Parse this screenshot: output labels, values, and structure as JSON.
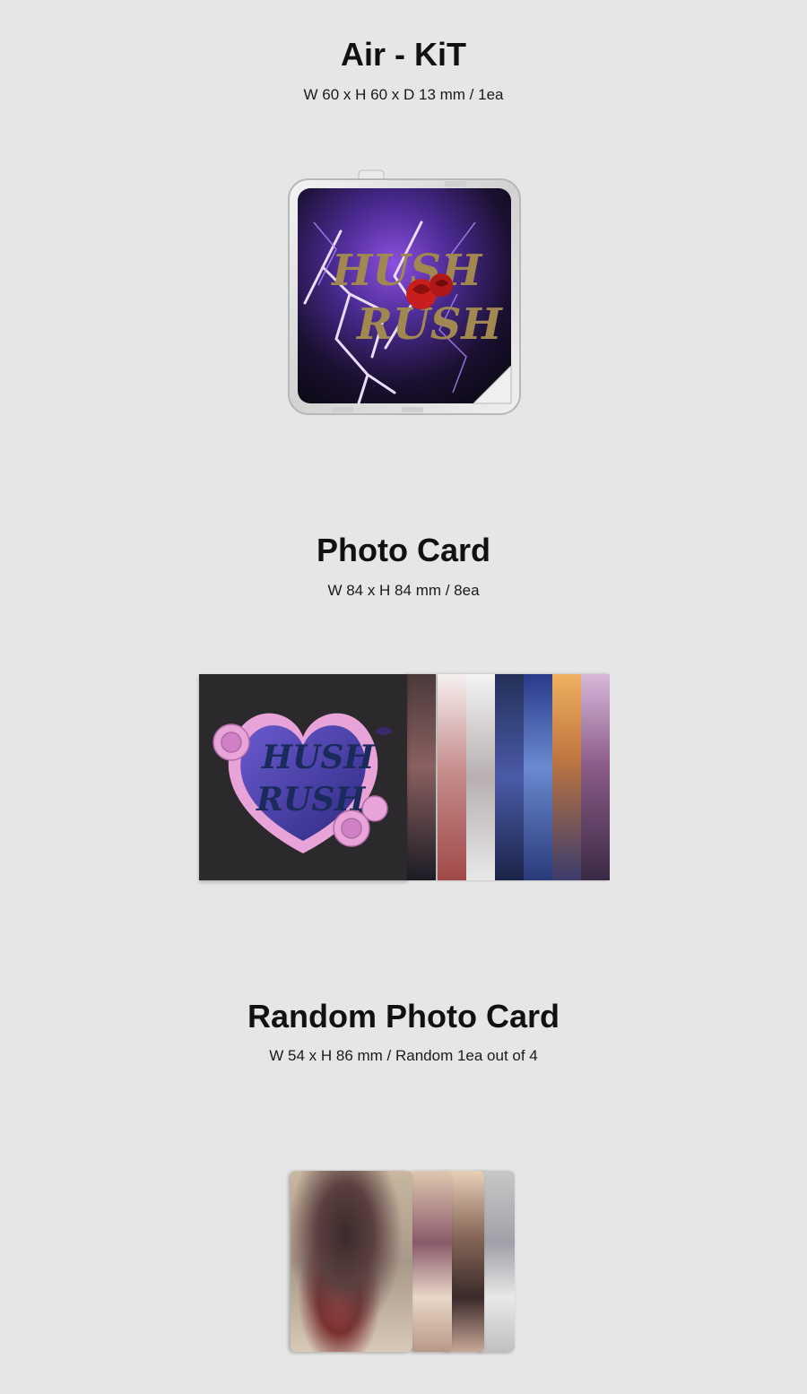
{
  "sections": {
    "air_kit": {
      "title": "Air - KiT",
      "spec": "W 60 x H 60 x D 13 mm / 1ea"
    },
    "photo_card": {
      "title": "Photo Card",
      "spec": "W 84 x H 84 mm / 8ea"
    },
    "random_photo_card": {
      "title": "Random Photo Card",
      "spec": "W 54 x H 86 mm / Random 1ea out of 4"
    }
  },
  "artwork": {
    "logo_line1": "HUSH",
    "logo_line2": "RUSH"
  },
  "colors": {
    "background": "#e6e6e6",
    "accent_purple": "#7b4fd6",
    "logo_gold": "#a08850",
    "heart_pink": "#e8a4d8",
    "heart_blue": "#4a4ea8"
  }
}
